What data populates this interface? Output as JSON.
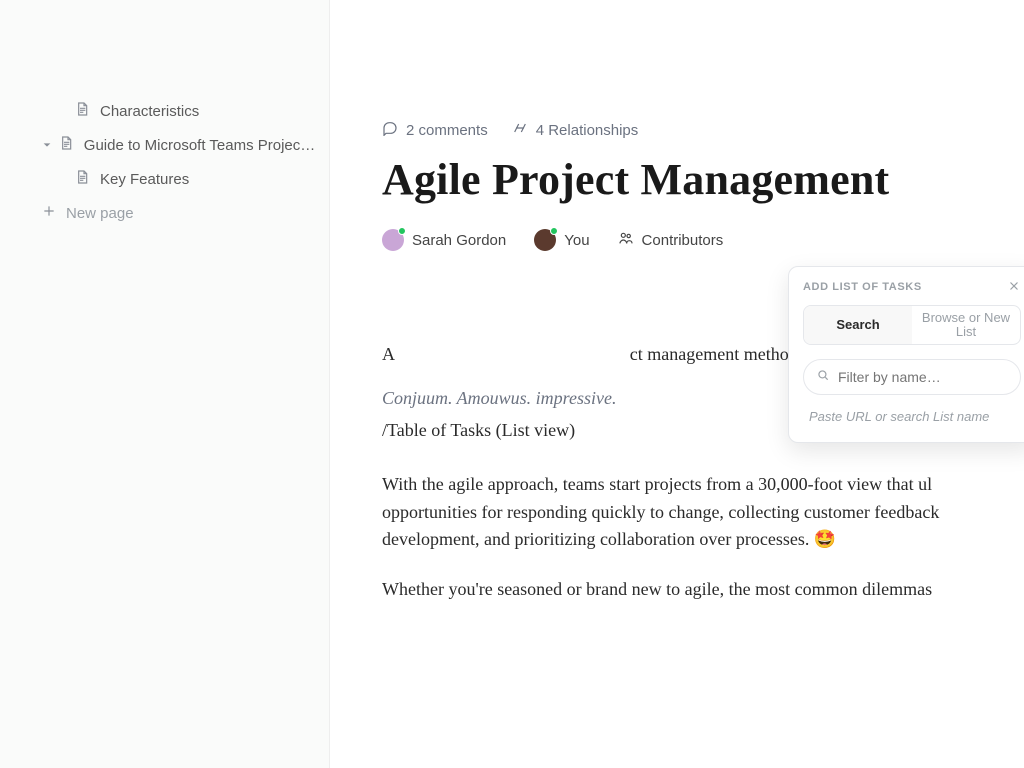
{
  "sidebar": {
    "items": [
      {
        "label": "Characteristics",
        "type": "page",
        "level": 2
      },
      {
        "label": "Guide to Microsoft Teams Project…",
        "type": "page-expandable",
        "level": 1
      },
      {
        "label": "Key Features",
        "type": "page",
        "level": 2
      },
      {
        "label": "New page",
        "type": "new",
        "level": 1
      }
    ]
  },
  "meta": {
    "comments": "2 comments",
    "relationships": "4  Relationships"
  },
  "title": "Agile Project Management",
  "people": {
    "p1": "Sarah Gordon",
    "p2": "You",
    "p3": "Contributors"
  },
  "body": {
    "line1_fragment": "ct management methodology.",
    "italic_partial": "Conjuum. Amouwus. impressive.",
    "slash": "/Table of Tasks (List view)",
    "para1": "With the agile approach, teams start projects from a 30,000-foot view that ul opportunities for responding quickly to change, collecting customer feedback development, and prioritizing collaboration over processes. 🤩",
    "para2": "Whether you're seasoned or brand new to agile, the most common dilemmas"
  },
  "popover": {
    "title": "ADD LIST OF TASKS",
    "tab_search": "Search",
    "tab_browse": "Browse or New List",
    "filter_placeholder": "Filter by name…",
    "hint": "Paste URL or search List name"
  },
  "colors": {
    "avatar1": "#c9a6d6",
    "avatar2": "#5b3a2e"
  }
}
